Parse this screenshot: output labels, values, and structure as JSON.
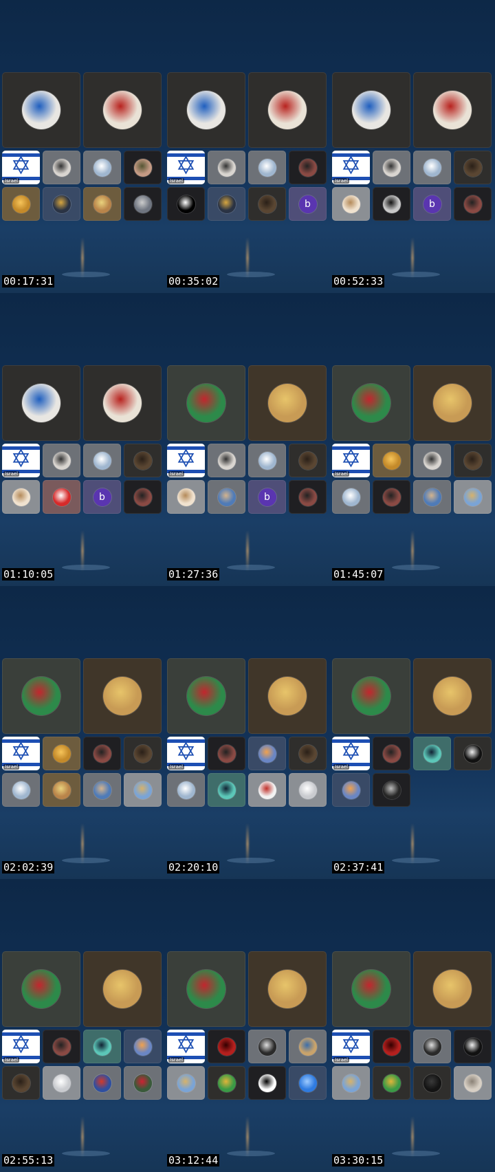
{
  "flag_label": "Israel",
  "frames": [
    {
      "time": "00:17:31",
      "big": [
        "ambulance",
        "palestine-flag-person"
      ],
      "small": [
        "israel-flag",
        "face",
        "lightning",
        "hand",
        "fire",
        "star",
        "medallion",
        "person"
      ]
    },
    {
      "time": "00:35:02",
      "big": [
        "ambulance",
        "palestine-flag-person"
      ],
      "small": [
        "israel-flag",
        "face",
        "lightning",
        "woman",
        "olam",
        "star",
        "dark-person",
        "b"
      ]
    },
    {
      "time": "00:52:33",
      "big": [
        "ambulance",
        "palestine-flag-person"
      ],
      "small": [
        "israel-flag",
        "face",
        "lightning",
        "dark-person",
        "music",
        "bw-face",
        "b",
        "woman"
      ]
    },
    {
      "time": "01:10:05",
      "big": [
        "ambulance",
        "palestine-flag-person"
      ],
      "small": [
        "israel-flag",
        "face",
        "lightning",
        "dark-person",
        "music",
        "lebanon",
        "b",
        "woman"
      ]
    },
    {
      "time": "01:27:36",
      "big": [
        "palestine-flag",
        "jerusalem"
      ],
      "small": [
        "israel-flag",
        "face",
        "lightning",
        "dark-person",
        "music",
        "man-blue",
        "b",
        "woman"
      ]
    },
    {
      "time": "01:45:07",
      "big": [
        "palestine-flag",
        "jerusalem"
      ],
      "small": [
        "israel-flag",
        "fire",
        "face",
        "dark-person",
        "lightning",
        "woman",
        "man-blue",
        "landscape"
      ]
    },
    {
      "time": "02:02:39",
      "big": [
        "palestine-flag",
        "jerusalem"
      ],
      "small": [
        "israel-flag",
        "fire",
        "woman",
        "dark-person",
        "lightning",
        "medallion",
        "man-blue",
        "landscape"
      ]
    },
    {
      "time": "02:20:10",
      "big": [
        "palestine-flag",
        "jerusalem"
      ],
      "small": [
        "israel-flag",
        "woman",
        "candle",
        "dark-person",
        "lightning",
        "teal-logo",
        "stamp",
        "default-user"
      ]
    },
    {
      "time": "02:37:41",
      "big": [
        "palestine-flag",
        "jerusalem"
      ],
      "small": [
        "israel-flag",
        "woman",
        "teal-logo",
        "masked",
        "candle",
        "bw-man"
      ]
    },
    {
      "time": "02:55:13",
      "big": [
        "palestine-flag",
        "jerusalem"
      ],
      "small": [
        "israel-flag",
        "woman",
        "teal-logo",
        "candle",
        "dark-person",
        "default-user",
        "flags-collage",
        "protest-photo"
      ]
    },
    {
      "time": "03:12:44",
      "big": [
        "palestine-flag",
        "jerusalem"
      ],
      "small": [
        "israel-flag",
        "red-emblem",
        "cat",
        "cartoon",
        "landscape",
        "green-woman",
        "just-do-it",
        "blue-grid"
      ]
    },
    {
      "time": "03:30:15",
      "big": [
        "palestine-flag",
        "jerusalem"
      ],
      "small": [
        "israel-flag",
        "red-emblem",
        "cat",
        "horned-mask",
        "landscape",
        "green-woman",
        "black-figure",
        "old-man"
      ]
    }
  ],
  "avatar_styles": {
    "ambulance": {
      "tile": "dark",
      "av": "#e8e6e2",
      "ring": "#1f5fbf"
    },
    "palestine-flag-person": {
      "tile": "dark",
      "av": "#e9e2d6",
      "ring": "#b8231f"
    },
    "palestine-flag": {
      "tile": "olive",
      "av": "#2d8a4a",
      "ring": "#c2262e"
    },
    "jerusalem": {
      "tile": "brown",
      "av": "#c89b55",
      "ring": "#e7c46a"
    },
    "face": {
      "tile": "gray",
      "av": "#d9d5d0",
      "ring": "#333"
    },
    "lightning": {
      "tile": "gray",
      "av": "#9fb6cf",
      "ring": "#ffffff"
    },
    "hand": {
      "tile": "black",
      "av": "#c49a84",
      "ring": "#553"
    },
    "fire": {
      "tile": "tan",
      "av": "#c48a2a",
      "ring": "#f6c45a"
    },
    "star": {
      "tile": "navy",
      "av": "#2a3344",
      "ring": "#d7a640"
    },
    "medallion": {
      "tile": "tan",
      "av": "#b9844a",
      "ring": "#e9d27d"
    },
    "person": {
      "tile": "black",
      "av": "#6f7580",
      "ring": "#ccc"
    },
    "woman": {
      "tile": "black",
      "av": "#8a4a44",
      "ring": "#222"
    },
    "olam": {
      "tile": "black",
      "av": "#000000",
      "ring": "#ffffff"
    },
    "dark-person": {
      "tile": "dark",
      "av": "#5a4632",
      "ring": "#2a2018"
    },
    "b": {
      "tile": "purple",
      "av": "#5a35b0",
      "ring": "#5a35b0",
      "letter": "b"
    },
    "music": {
      "tile": "lgray",
      "av": "#f0e2cf",
      "ring": "#b48a5a"
    },
    "bw-face": {
      "tile": "black",
      "av": "#c8c8c8",
      "ring": "#111"
    },
    "lebanon": {
      "tile": "rose",
      "av": "#d62a2a",
      "ring": "#ffffff"
    },
    "man-blue": {
      "tile": "gray",
      "av": "#4f7bb8",
      "ring": "#d3b38d"
    },
    "landscape": {
      "tile": "lgray",
      "av": "#7aa4d6",
      "ring": "#d6b26c"
    },
    "candle": {
      "tile": "navy",
      "av": "#6a86c4",
      "ring": "#f0a14e"
    },
    "teal-logo": {
      "tile": "teal",
      "av": "#5cc7b8",
      "ring": "#123"
    },
    "stamp": {
      "tile": "lgray",
      "av": "#f2f2f2",
      "ring": "#c0302a"
    },
    "default-user": {
      "tile": "lgray",
      "av": "#c9cbcf",
      "ring": "#ffffff"
    },
    "masked": {
      "tile": "dark",
      "av": "#111111",
      "ring": "#eeeeee"
    },
    "bw-man": {
      "tile": "black",
      "av": "#262626",
      "ring": "#bbbbbb"
    },
    "flags-collage": {
      "tile": "gray",
      "av": "#2f4fa0",
      "ring": "#d23a2a"
    },
    "protest-photo": {
      "tile": "gray",
      "av": "#3a5a3a",
      "ring": "#c23"
    },
    "red-emblem": {
      "tile": "black",
      "av": "#b5201e",
      "ring": "#300"
    },
    "cat": {
      "tile": "gray",
      "av": "#2a2a2a",
      "ring": "#ddd"
    },
    "cartoon": {
      "tile": "gray",
      "av": "#c9a36b",
      "ring": "#3d6ea9"
    },
    "green-woman": {
      "tile": "dark",
      "av": "#3b9a46",
      "ring": "#e0b43a"
    },
    "just-do-it": {
      "tile": "black",
      "av": "#ffffff",
      "ring": "#000"
    },
    "blue-grid": {
      "tile": "navy",
      "av": "#2f7be0",
      "ring": "#9ecbff"
    },
    "horned-mask": {
      "tile": "black",
      "av": "#111",
      "ring": "#eee"
    },
    "black-figure": {
      "tile": "dark",
      "av": "#141414",
      "ring": "#3a3a3a"
    },
    "old-man": {
      "tile": "lgray",
      "av": "#d7cfc4",
      "ring": "#8a8176"
    }
  }
}
